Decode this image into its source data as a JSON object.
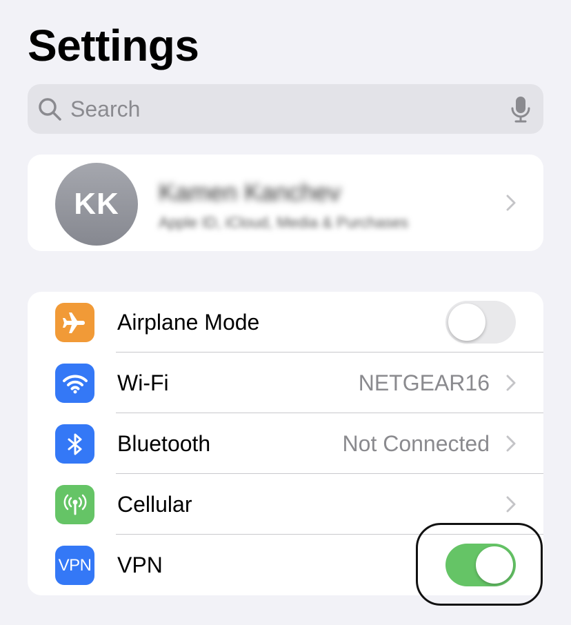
{
  "header": {
    "title": "Settings"
  },
  "search": {
    "placeholder": "Search"
  },
  "profile": {
    "initials": "KK",
    "name": "Kamen Kanchev",
    "subtitle": "Apple ID, iCloud, Media & Purchases"
  },
  "settings": {
    "rows": [
      {
        "label": "Airplane Mode",
        "icon": "airplane-icon",
        "icon_color": "#f19a37",
        "toggle": false
      },
      {
        "label": "Wi-Fi",
        "icon": "wifi-icon",
        "icon_color": "#3478f6",
        "value": "NETGEAR16"
      },
      {
        "label": "Bluetooth",
        "icon": "bluetooth-icon",
        "icon_color": "#3478f6",
        "value": "Not Connected"
      },
      {
        "label": "Cellular",
        "icon": "cellular-icon",
        "icon_color": "#65c466"
      },
      {
        "label": "VPN",
        "icon": "vpn-icon",
        "icon_text": "VPN",
        "icon_color": "#3478f6",
        "toggle": true
      }
    ]
  },
  "colors": {
    "background": "#f2f2f7",
    "toggle_on": "#65c466",
    "toggle_off": "#e9e9eb",
    "secondary_text": "#8a8a8e"
  }
}
